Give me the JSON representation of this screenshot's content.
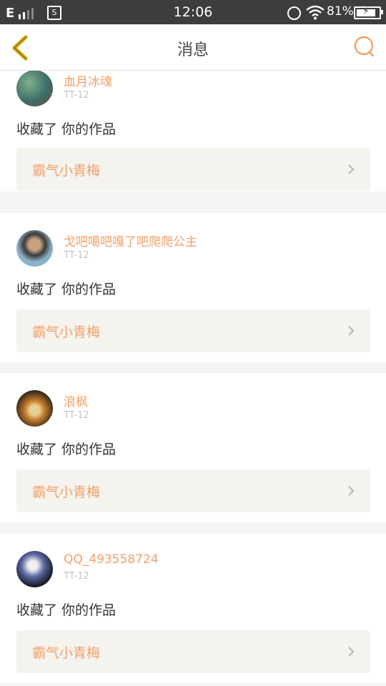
{
  "status_bar": {
    "network": "E",
    "time": "12:06",
    "battery": "81%"
  },
  "header": {
    "title": "消息",
    "back_icon": "chevron-left-icon",
    "search_icon": "search-icon"
  },
  "colors": {
    "accent_orange": "#f2a06a",
    "back_yellow": "#c8a000",
    "card_bg": "#ffffff",
    "work_bg": "#f4f3ee",
    "divider": "#f4f4f4"
  },
  "messages": [
    {
      "user": "血月冰魂",
      "time": "TT-12",
      "action": "收藏了 你的作品",
      "work_title": "霸气小青梅"
    },
    {
      "user": "戈吧噶吧嘎了吧爬爬公主",
      "time": "TT-12",
      "action": "收藏了 你的作品",
      "work_title": "霸气小青梅"
    },
    {
      "user": "浪枫",
      "time": "TT-12",
      "action": "收藏了 你的作品",
      "work_title": "霸气小青梅"
    },
    {
      "user": "QQ_493558724",
      "time": "TT-12",
      "action": "收藏了 你的作品",
      "work_title": "霸气小青梅"
    }
  ]
}
